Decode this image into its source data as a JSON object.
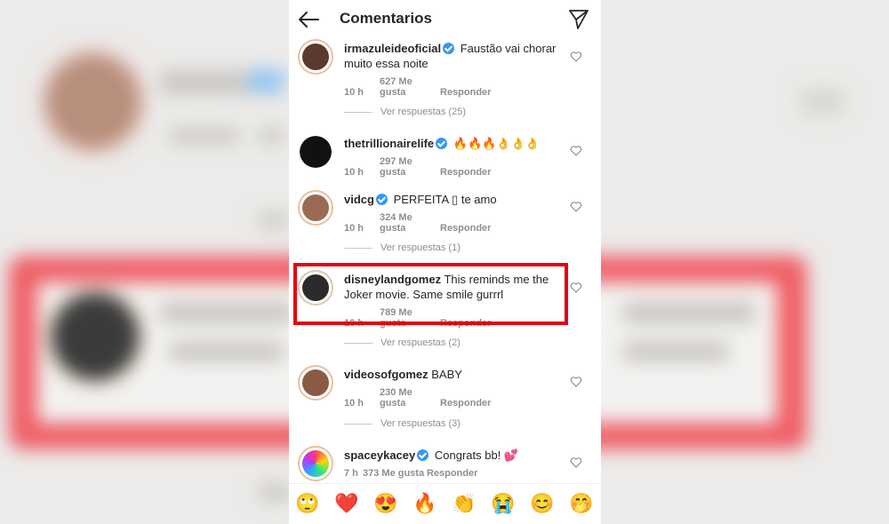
{
  "header": {
    "title": "Comentarios"
  },
  "comments": [
    {
      "username": "irmazuleideoficial",
      "verified": true,
      "text": "Faustão vai chorar muito essa noite",
      "time": "10 h",
      "likes": "627 Me gusta",
      "reply": "Responder",
      "view_replies": "Ver respuestas (25)"
    },
    {
      "username": "thetrillionairelife",
      "verified": true,
      "text": "🔥🔥🔥👌👌👌",
      "time": "10 h",
      "likes": "297 Me gusta",
      "reply": "Responder"
    },
    {
      "username": "vidcg",
      "verified": true,
      "text": "PERFEITA ▯ te amo",
      "time": "10 h",
      "likes": "324 Me gusta",
      "reply": "Responder",
      "view_replies": "Ver respuestas (1)"
    },
    {
      "username": "disneylandgomez",
      "verified": false,
      "text": "This reminds me the Joker movie. Same smile gurrrl",
      "time": "10 h",
      "likes": "789 Me gusta",
      "reply": "Responder",
      "view_replies": "Ver respuestas (2)"
    },
    {
      "username": "videosofgomez",
      "verified": false,
      "text": "BABY",
      "time": "10 h",
      "likes": "230 Me gusta",
      "reply": "Responder",
      "view_replies": "Ver respuestas (3)"
    },
    {
      "username": "spaceykacey",
      "verified": true,
      "text": "Congrats bb! 💕",
      "time": "7 h",
      "likes": "373 Me gusta",
      "reply": "Responder"
    }
  ],
  "emoji_bar": [
    "🙄",
    "❤️",
    "😍",
    "🔥",
    "👏",
    "😭",
    "😊",
    "🤭"
  ],
  "colors": {
    "highlight": "#e6000e",
    "verified": "#3897f0",
    "meta": "#8e8e8e"
  }
}
